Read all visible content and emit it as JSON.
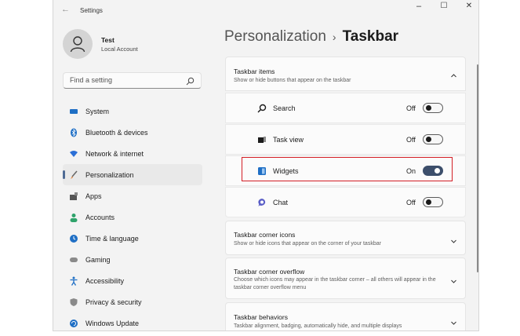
{
  "window": {
    "back_icon": "back-arrow-icon",
    "title": "Settings",
    "minimize": "–",
    "maximize": "☐",
    "close": "✕"
  },
  "user": {
    "name": "Test",
    "account_type": "Local Account",
    "avatar_icon": "person-icon"
  },
  "search": {
    "placeholder": "Find a setting",
    "value": ""
  },
  "nav": {
    "items": [
      {
        "label": "System",
        "icon": "monitor-icon",
        "color": "#1f6fc5"
      },
      {
        "label": "Bluetooth & devices",
        "icon": "bluetooth-icon",
        "color": "#1f6fc5"
      },
      {
        "label": "Network & internet",
        "icon": "wifi-icon",
        "color": "#2b6fd6"
      },
      {
        "label": "Personalization",
        "icon": "brush-icon",
        "color": "#e07b2c",
        "selected": true
      },
      {
        "label": "Apps",
        "icon": "apps-icon",
        "color": "#555555"
      },
      {
        "label": "Accounts",
        "icon": "person-icon",
        "color": "#2fa36b"
      },
      {
        "label": "Time & language",
        "icon": "globe-clock-icon",
        "color": "#1f6fc5"
      },
      {
        "label": "Gaming",
        "icon": "gamepad-icon",
        "color": "#8a8a8a"
      },
      {
        "label": "Accessibility",
        "icon": "accessibility-icon",
        "color": "#1f6fc5"
      },
      {
        "label": "Privacy & security",
        "icon": "shield-icon",
        "color": "#8a8a8a"
      },
      {
        "label": "Windows Update",
        "icon": "update-icon",
        "color": "#1f6fc5"
      }
    ]
  },
  "breadcrumb": {
    "parent": "Personalization",
    "separator": "›",
    "current": "Taskbar"
  },
  "taskbar_items": {
    "title": "Taskbar items",
    "description": "Show or hide buttons that appear on the taskbar",
    "rows": [
      {
        "label": "Search",
        "state": "Off",
        "on": false,
        "icon": "search-icon"
      },
      {
        "label": "Task view",
        "state": "Off",
        "on": false,
        "icon": "task-view-icon"
      },
      {
        "label": "Widgets",
        "state": "On",
        "on": true,
        "icon": "widgets-icon"
      },
      {
        "label": "Chat",
        "state": "Off",
        "on": false,
        "icon": "chat-icon"
      }
    ]
  },
  "sections": [
    {
      "title": "Taskbar corner icons",
      "description": "Show or hide icons that appear on the corner of your taskbar"
    },
    {
      "title": "Taskbar corner overflow",
      "description": "Choose which icons may appear in the taskbar corner – all others will appear in the taskbar corner overflow menu"
    },
    {
      "title": "Taskbar behaviors",
      "description": "Taskbar alignment, badging, automatically hide, and multiple displays"
    }
  ],
  "colors": {
    "accent": "#3c4e6b",
    "highlight": "#d31e25"
  }
}
